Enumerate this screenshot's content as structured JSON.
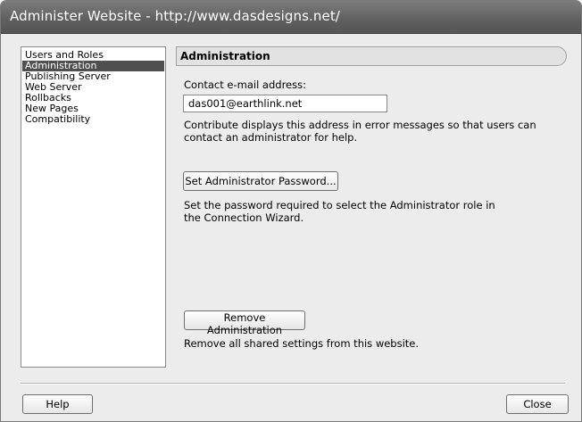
{
  "window": {
    "title": "Administer Website - http://www.dasdesigns.net/"
  },
  "sidebar": {
    "items": [
      {
        "label": "Users and Roles",
        "selected": false
      },
      {
        "label": "Administration",
        "selected": true
      },
      {
        "label": "Publishing Server",
        "selected": false
      },
      {
        "label": "Web Server",
        "selected": false
      },
      {
        "label": "Rollbacks",
        "selected": false
      },
      {
        "label": "New Pages",
        "selected": false
      },
      {
        "label": "Compatibility",
        "selected": false
      }
    ]
  },
  "panel": {
    "title": "Administration",
    "email_label": "Contact e-mail address:",
    "email_value": "das001@earthlink.net",
    "email_description": "Contribute displays this address in error messages so that users can contact an administrator for help.",
    "set_password_button": "Set Administrator Password...",
    "password_description": "Set the password required to select the Administrator role in the Connection Wizard.",
    "remove_button": "Remove Administration",
    "remove_description": "Remove all shared settings from this website."
  },
  "footer": {
    "help_button": "Help",
    "close_button": "Close"
  }
}
